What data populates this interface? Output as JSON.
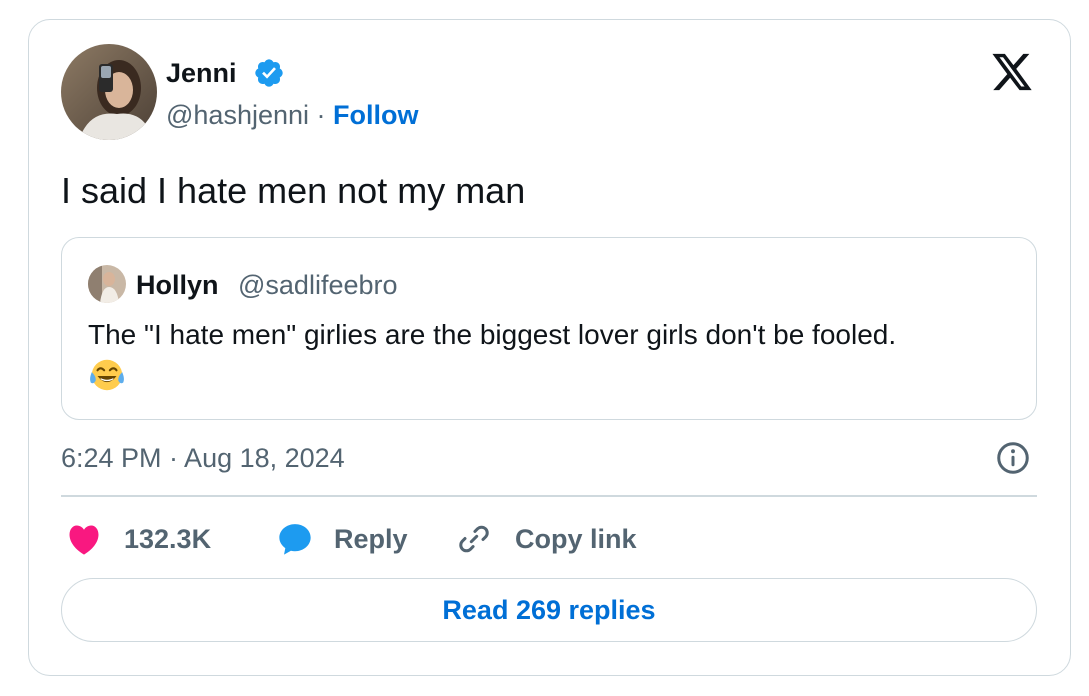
{
  "tweet": {
    "author": {
      "name": "Jenni",
      "handle": "@hashjenni",
      "separator": "·",
      "follow_label": "Follow",
      "verified_icon": "verified-badge-icon"
    },
    "brand_icon": "x-logo-icon",
    "text": "I said I hate men not my man",
    "quoted": {
      "name": "Hollyn",
      "handle": "@sadlifeebro",
      "text": "The \"I hate men\" girlies are the biggest lover girls don't be fooled.",
      "emoji": "face-with-tears-of-joy-icon"
    },
    "timestamp": "6:24 PM · Aug 18, 2024",
    "actions": {
      "like_count": "132.3K",
      "reply_label": "Reply",
      "copy_label": "Copy link"
    },
    "read_replies_label": "Read 269 replies"
  },
  "colors": {
    "text_primary": "#0f1419",
    "text_secondary": "#536471",
    "link_blue": "#006fd6",
    "verified_blue": "#1d9bf0",
    "like_pink": "#f91880",
    "reply_blue": "#1d9bf0",
    "border": "#cfd9de"
  }
}
